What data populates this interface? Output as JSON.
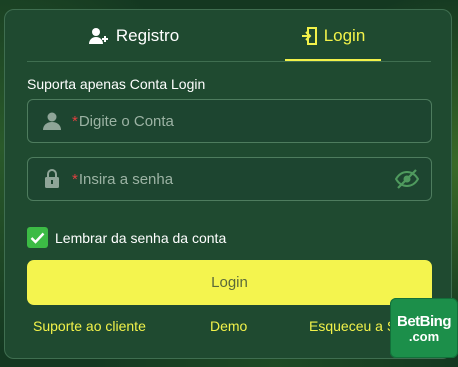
{
  "tabs": {
    "register_label": "Registro",
    "login_label": "Login",
    "active": "login"
  },
  "form": {
    "note": "Suporta apenas Conta Login",
    "account": {
      "required_mark": "*",
      "placeholder": "Digite o Conta"
    },
    "password": {
      "required_mark": "*",
      "placeholder": "Insira a senha"
    },
    "remember_label": "Lembrar da senha da conta",
    "remember_checked": true,
    "submit_label": "Login"
  },
  "footer": {
    "support": "Suporte ao cliente",
    "demo": "Demo",
    "forgot": "Esqueceu a Senha"
  },
  "brand": {
    "line1_a": "Bet",
    "line1_b": "Bing",
    "line2": ".com"
  },
  "colors": {
    "accent": "#f2f24a",
    "panel": "#1f4a30",
    "checkbox": "#3cbb45"
  },
  "icons": [
    "add-user-icon",
    "login-door-icon",
    "user-icon",
    "lock-icon",
    "eye-hidden-icon",
    "check-icon"
  ]
}
